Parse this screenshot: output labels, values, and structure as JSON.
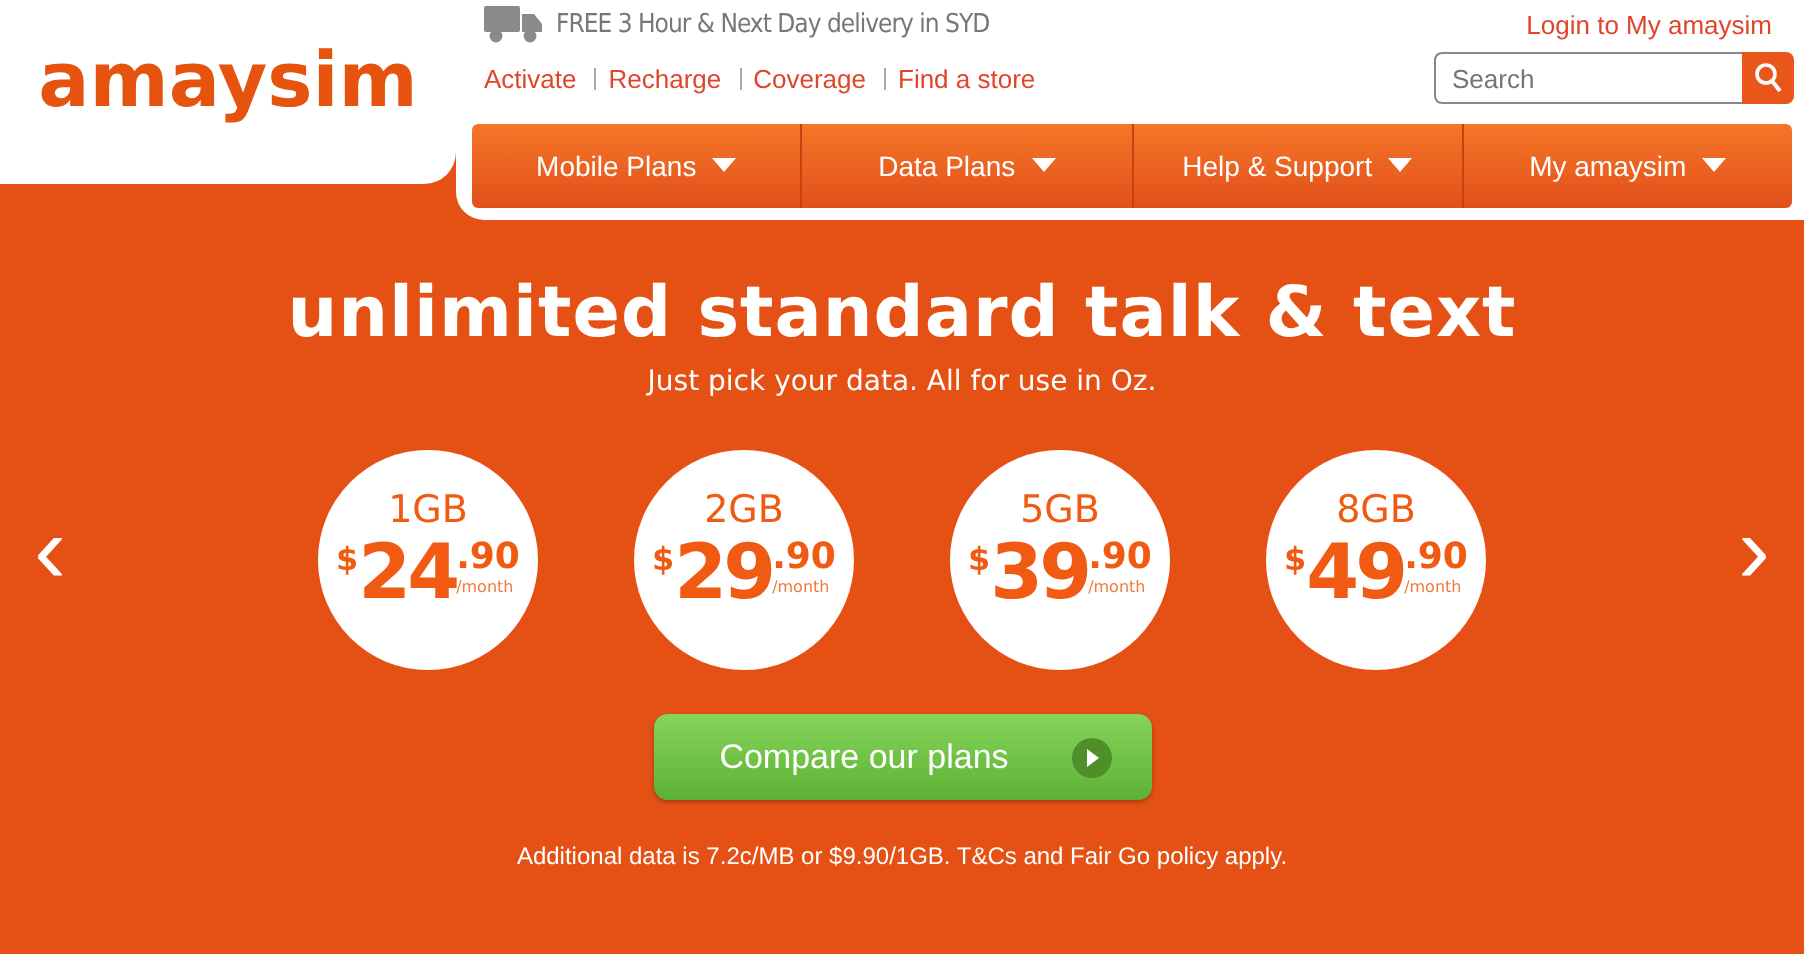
{
  "logo": "amaysim",
  "delivery": "FREE 3 Hour & Next Day delivery in SYD",
  "login": "Login to My amaysim",
  "links": [
    "Activate",
    "Recharge",
    "Coverage",
    "Find a store"
  ],
  "search": {
    "placeholder": "Search"
  },
  "nav": [
    "Mobile Plans",
    "Data Plans",
    "Help & Support",
    "My amaysim"
  ],
  "hero": {
    "title": "unlimited standard talk & text",
    "subtitle": "Just pick your data. All for use in Oz.",
    "prev": "‹",
    "next": "›",
    "plans": [
      {
        "size": "1GB",
        "currency": "$",
        "dollars": "24",
        "cents": ".90",
        "period": "/month"
      },
      {
        "size": "2GB",
        "currency": "$",
        "dollars": "29",
        "cents": ".90",
        "period": "/month"
      },
      {
        "size": "5GB",
        "currency": "$",
        "dollars": "39",
        "cents": ".90",
        "period": "/month"
      },
      {
        "size": "8GB",
        "currency": "$",
        "dollars": "49",
        "cents": ".90",
        "period": "/month"
      }
    ],
    "cta": "Compare our plans",
    "footnote": "Additional data is 7.2c/MB or $9.90/1GB. T&Cs and Fair Go policy apply."
  }
}
